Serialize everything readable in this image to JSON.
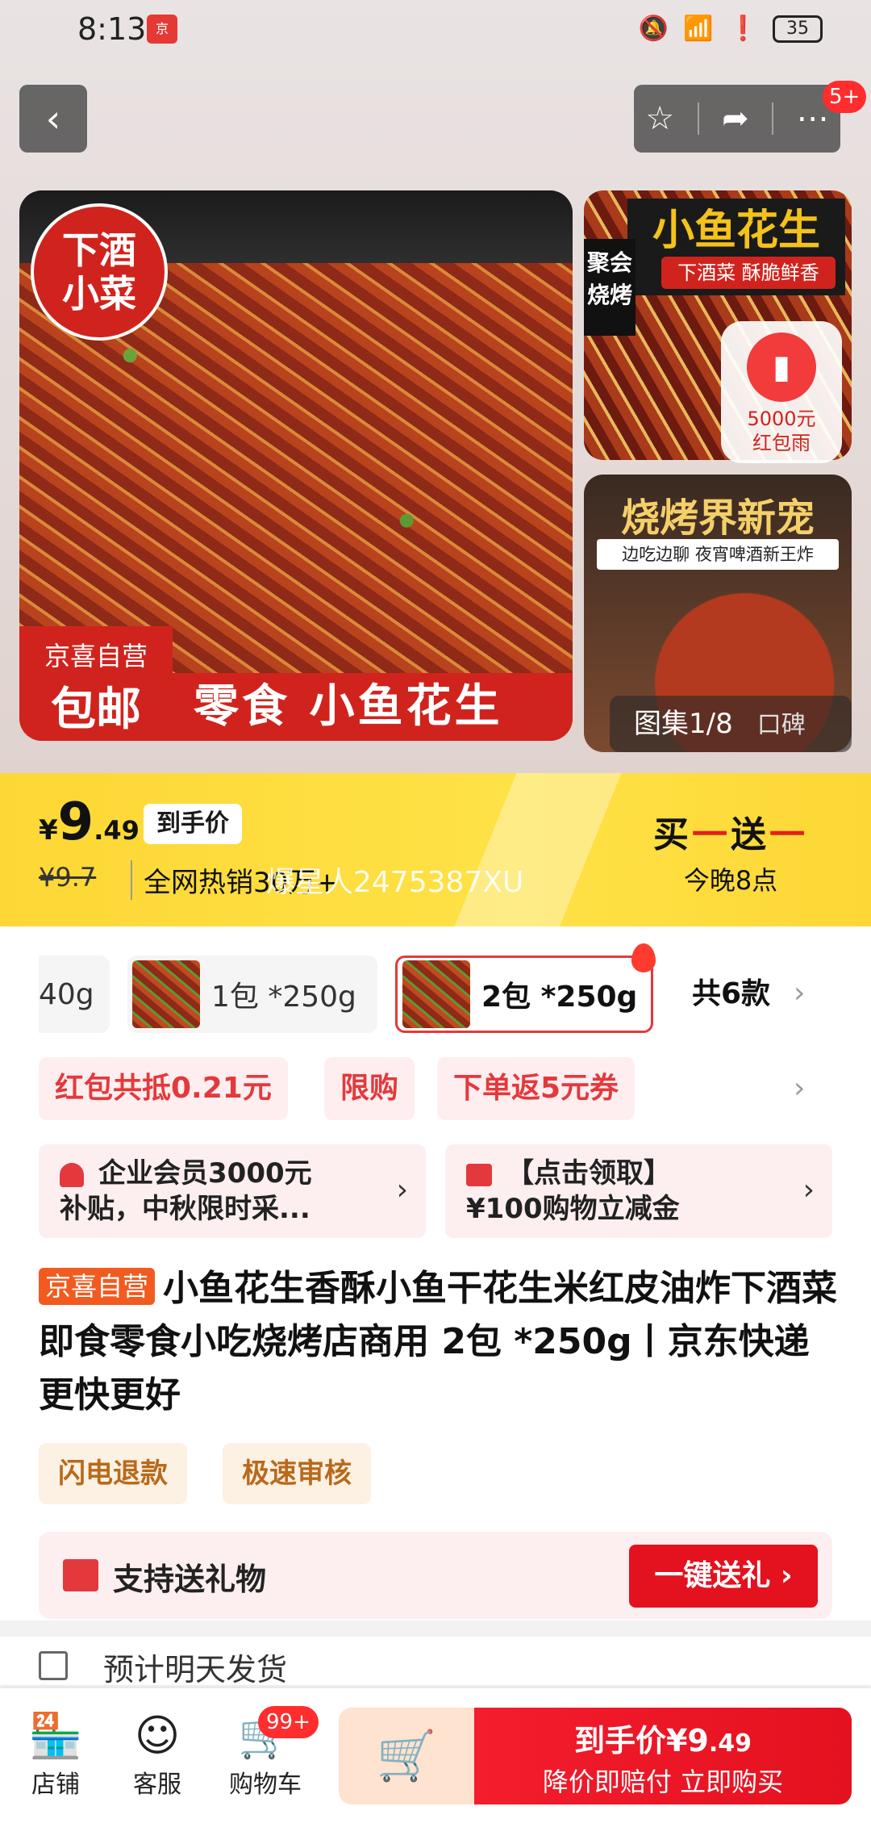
{
  "status": {
    "time": "8:13",
    "battery": "35"
  },
  "nav": {
    "badge": "5+"
  },
  "hero": {
    "tag_line1": "下酒",
    "tag_line2": "小菜",
    "jx_label": "京喜自营",
    "jx_free": "包邮",
    "bottom_text": "零食 小鱼花生",
    "thumb1_title": "小鱼花生",
    "thumb1_sub": "下酒菜 酥脆鲜香",
    "thumb1_side": "聚会烧烤",
    "redrain_amount": "5000元",
    "redrain_label": "红包雨",
    "thumb2_title": "烧烤界新宠",
    "thumb2_sub": "边吃边聊 夜宵啤酒新王炸",
    "gallery": "图集1/8",
    "gallery_reviews": "口碑"
  },
  "price": {
    "currency": "¥",
    "int": "9",
    "dec": ".49",
    "tag": "到手价",
    "old": "¥9.7",
    "hot": "全网热销30万+",
    "promo_a1": "买",
    "promo_a2": "一",
    "promo_a3": "送",
    "promo_a4": "一",
    "promo_b": "今晚8点",
    "watermark": "爆星人2475387XU"
  },
  "specs": {
    "partial": "40g",
    "item1": "1包 *250g",
    "item2": "2包 *250g",
    "count": "共6款"
  },
  "coupons": [
    "红包共抵0.21元",
    "限购",
    "下单返5元券"
  ],
  "benefits": {
    "b1_l1": "企业会员3000元",
    "b1_l2": "补贴，中秋限时采...",
    "b2_l1": "【点击领取】",
    "b2_l2": "¥100购物立减金"
  },
  "title": {
    "badge": "京喜自营",
    "text": "小鱼花生香酥小鱼干花生米红皮油炸下酒菜即食零食小吃烧烤店商用 2包 *250g丨京东快递 更快更好"
  },
  "services": [
    "闪电退款",
    "极速审核"
  ],
  "gift": {
    "text": "支持送礼物",
    "button": "一键送礼 ›"
  },
  "ship": {
    "text": "预计明天发货"
  },
  "bottom": {
    "shop": "店铺",
    "service": "客服",
    "cart": "购物车",
    "cart_badge": "99+",
    "buy_price_label": "到手价¥9",
    "buy_price_dec": ".49",
    "buy_sub": "降价即赔付 立即购买"
  },
  "colors": {
    "accent": "#e4393c",
    "price_bar": "#fee247",
    "buy": "#e4111f"
  }
}
